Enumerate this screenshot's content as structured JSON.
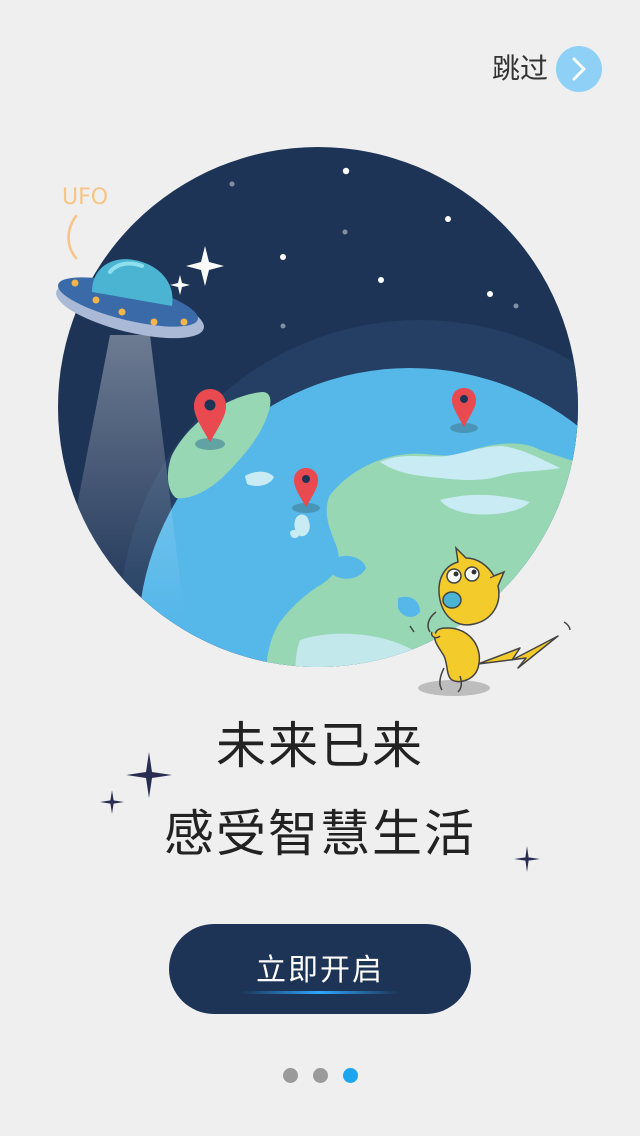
{
  "skip": {
    "label": "跳过",
    "icon": "chevron-right-icon"
  },
  "illustration": {
    "ufo_label": "UFO",
    "icons": [
      "ufo-icon",
      "earth-globe",
      "location-pin-icon",
      "yellow-cat-mascot"
    ]
  },
  "headline": {
    "line1": "未来已来",
    "line2": "感受智慧生活"
  },
  "cta": {
    "label": "立即开启"
  },
  "pagination": {
    "count": 3,
    "active_index": 2
  },
  "colors": {
    "background": "#efefef",
    "night_sky": "#1e3457",
    "ocean": "#56b7e9",
    "land": "#97d7b3",
    "pin": "#e84a4f",
    "cta": "#1d3456",
    "accent": "#1da5ee",
    "skip_circle": "#8ed0f6"
  }
}
